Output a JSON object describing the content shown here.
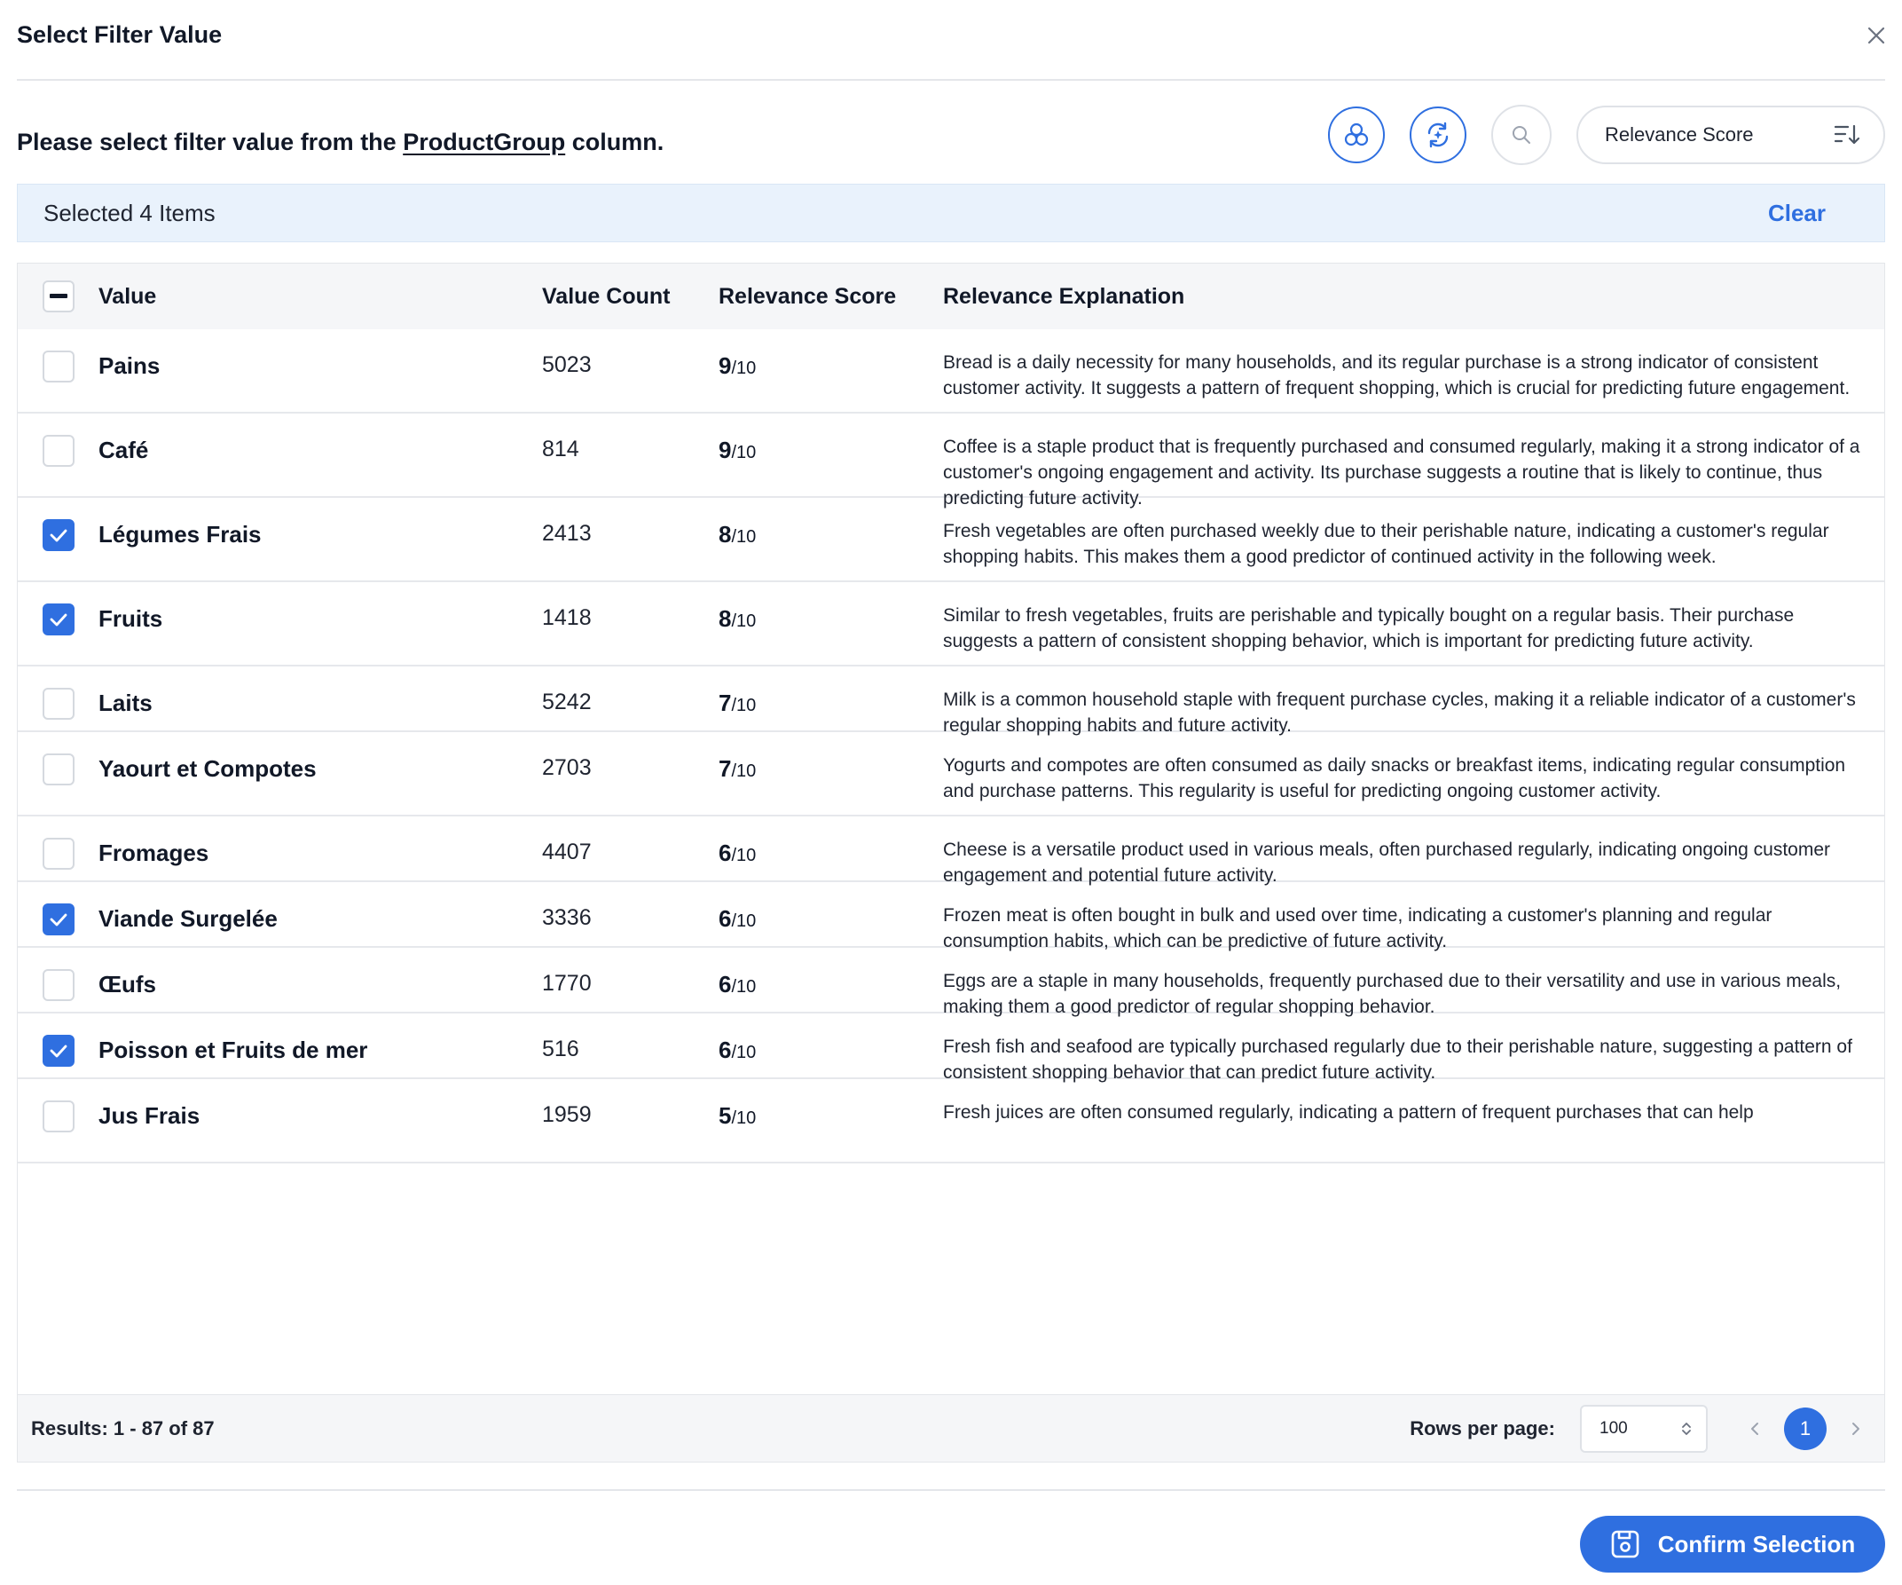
{
  "dialog": {
    "title": "Select Filter Value",
    "prompt_before": "Please select filter value from the ",
    "prompt_column": "ProductGroup",
    "prompt_after": " column."
  },
  "toolbar": {
    "icons": [
      "cluster-icon",
      "refresh-sparkle-icon",
      "search-icon",
      "sort-icon"
    ],
    "sort_label": "Relevance Score"
  },
  "selection": {
    "summary": "Selected 4 Items",
    "clear_label": "Clear"
  },
  "table": {
    "headers": {
      "value": "Value",
      "count": "Value Count",
      "score": "Relevance Score",
      "explanation": "Relevance Explanation"
    },
    "rows": [
      {
        "checked": false,
        "value": "Pains",
        "count": "5023",
        "score": "9",
        "den": "/10",
        "exp": "Bread is a daily necessity for many households, and its regular purchase is a strong indicator of consistent customer activity. It suggests a pattern of frequent shopping, which is crucial for predicting future engagement."
      },
      {
        "checked": false,
        "value": "Café",
        "count": "814",
        "score": "9",
        "den": "/10",
        "exp": "Coffee is a staple product that is frequently purchased and consumed regularly, making it a strong indicator of a customer's ongoing engagement and activity. Its purchase suggests a routine that is likely to continue, thus predicting future activity."
      },
      {
        "checked": true,
        "value": "Légumes Frais",
        "count": "2413",
        "score": "8",
        "den": "/10",
        "exp": "Fresh vegetables are often purchased weekly due to their perishable nature, indicating a customer's regular shopping habits. This makes them a good predictor of continued activity in the following week."
      },
      {
        "checked": true,
        "value": "Fruits",
        "count": "1418",
        "score": "8",
        "den": "/10",
        "exp": "Similar to fresh vegetables, fruits are perishable and typically bought on a regular basis. Their purchase suggests a pattern of consistent shopping behavior, which is important for predicting future activity."
      },
      {
        "checked": false,
        "value": "Laits",
        "count": "5242",
        "score": "7",
        "den": "/10",
        "exp": "Milk is a common household staple with frequent purchase cycles, making it a reliable indicator of a customer's regular shopping habits and future activity."
      },
      {
        "checked": false,
        "value": "Yaourt et Compotes",
        "count": "2703",
        "score": "7",
        "den": "/10",
        "exp": "Yogurts and compotes are often consumed as daily snacks or breakfast items, indicating regular consumption and purchase patterns. This regularity is useful for predicting ongoing customer activity."
      },
      {
        "checked": false,
        "value": "Fromages",
        "count": "4407",
        "score": "6",
        "den": "/10",
        "exp": "Cheese is a versatile product used in various meals, often purchased regularly, indicating ongoing customer engagement and potential future activity."
      },
      {
        "checked": true,
        "value": "Viande Surgelée",
        "count": "3336",
        "score": "6",
        "den": "/10",
        "exp": "Frozen meat is often bought in bulk and used over time, indicating a customer's planning and regular consumption habits, which can be predictive of future activity."
      },
      {
        "checked": false,
        "value": "Œufs",
        "count": "1770",
        "score": "6",
        "den": "/10",
        "exp": "Eggs are a staple in many households, frequently purchased due to their versatility and use in various meals, making them a good predictor of regular shopping behavior."
      },
      {
        "checked": true,
        "value": "Poisson et Fruits de mer",
        "count": "516",
        "score": "6",
        "den": "/10",
        "exp": "Fresh fish and seafood are typically purchased regularly due to their perishable nature, suggesting a pattern of consistent shopping behavior that can predict future activity."
      },
      {
        "checked": false,
        "value": "Jus Frais",
        "count": "1959",
        "score": "5",
        "den": "/10",
        "exp": "Fresh juices are often consumed regularly, indicating a pattern of frequent purchases that can help"
      }
    ]
  },
  "footer": {
    "results": "Results: 1 - 87 of 87",
    "rows_per_page_label": "Rows per page:",
    "rows_per_page_value": "100",
    "current_page": "1"
  },
  "confirm_label": "Confirm Selection",
  "colors": {
    "accent": "#2f6fe0",
    "banner_bg": "#e9f2fc",
    "header_bg": "#f5f6f8"
  }
}
